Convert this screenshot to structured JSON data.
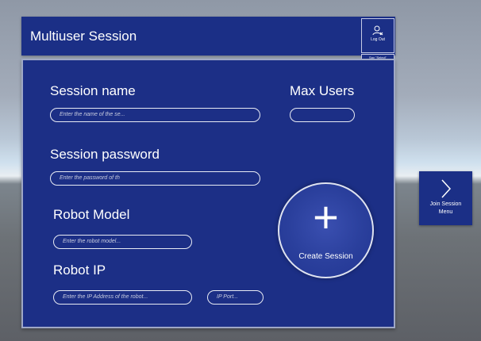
{
  "header": {
    "title": "Multiuser Session"
  },
  "logout": {
    "label": "Log Out",
    "hint": "Say \"Select\""
  },
  "form": {
    "session_name": {
      "label": "Session name",
      "placeholder": "Enter the name of the se..."
    },
    "max_users": {
      "label": "Max Users",
      "value": ""
    },
    "session_password": {
      "label": "Session password",
      "placeholder": "Enter the password of th"
    },
    "robot_model": {
      "label": "Robot Model",
      "placeholder": "Enter the robot model..."
    },
    "robot_ip": {
      "label": "Robot IP",
      "placeholder": "Enter the IP Address of the robot...",
      "port_placeholder": "IP Port..."
    }
  },
  "create": {
    "label": "Create Session",
    "icon": "plus-icon"
  },
  "join": {
    "label_line1": "Join Session",
    "label_line2": "Menu",
    "icon": "chevron-right-icon"
  }
}
